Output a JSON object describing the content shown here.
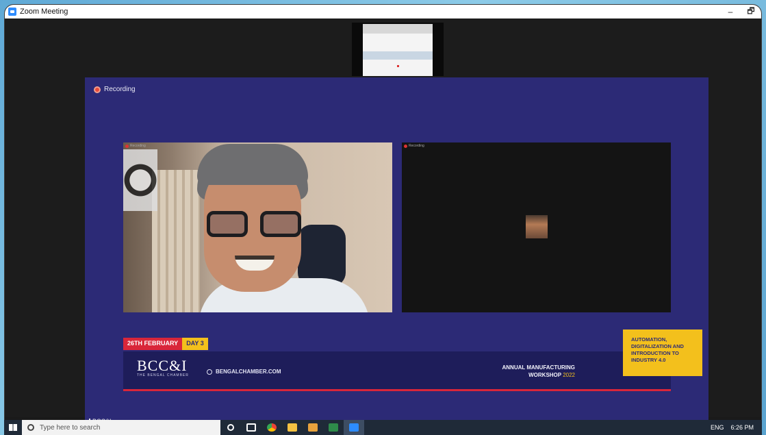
{
  "window": {
    "title": "Zoom Meeting",
    "minimize": "–",
    "restore": "🗗"
  },
  "recording": {
    "label": "Recording"
  },
  "tiles": {
    "left_rec": "Recording",
    "right_rec": "Recording"
  },
  "banner": {
    "date": "26TH FEBRUARY",
    "day": "DAY 3",
    "logo": "BCC&I",
    "logo_sub": "THE BENGAL CHAMBER",
    "website": "BENGALCHAMBER.COM",
    "workshop_line1": "ANNUAL MANUFACTURING",
    "workshop_line2": "WORKSHOP",
    "workshop_year": "2022",
    "topic": "AUTOMATION, DIGITALIZATION AND INTRODUCTION TO INDUSTRY 4.0"
  },
  "participant": {
    "name": "BCC&I"
  },
  "taskbar": {
    "search_placeholder": "Type here to search",
    "language": "ENG",
    "time": "6:26 PM",
    "icons": [
      "cortana-icon",
      "task-view-icon",
      "chrome-icon",
      "file-explorer-icon",
      "outlook-icon",
      "excel-icon",
      "zoom-icon"
    ]
  }
}
